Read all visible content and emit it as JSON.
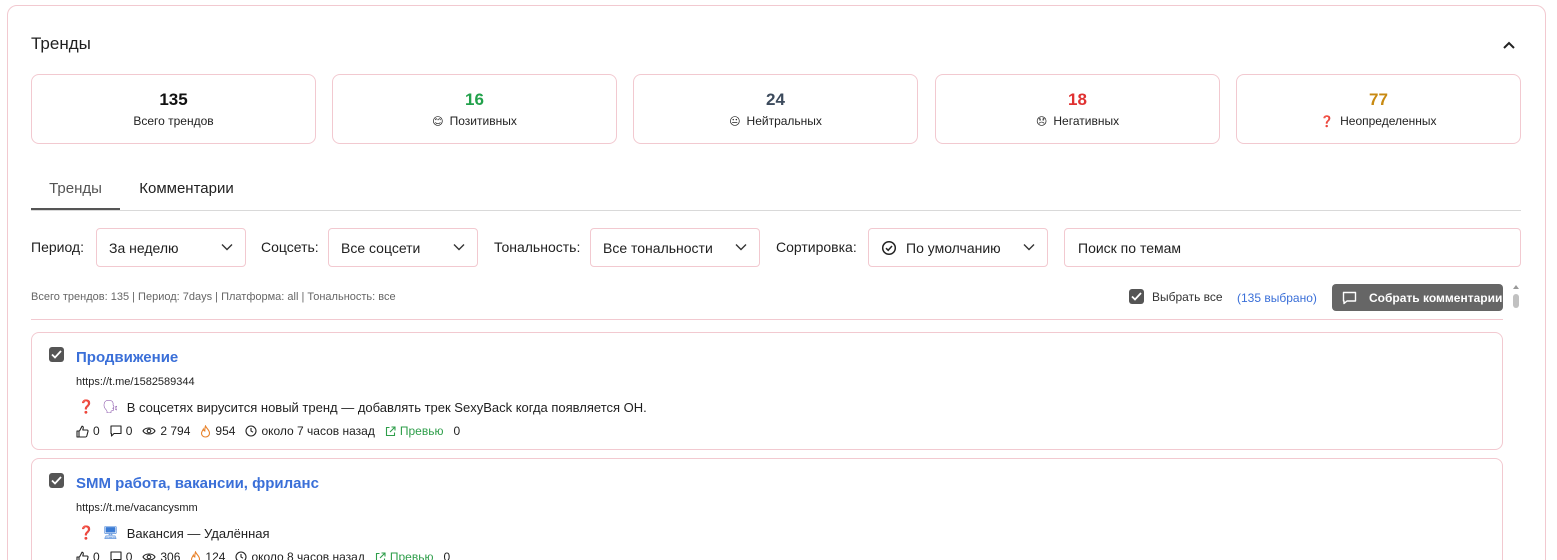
{
  "panel": {
    "title": "Тренды"
  },
  "stats": [
    {
      "value": "135",
      "label": "Всего трендов",
      "color": "#111111",
      "emoji": ""
    },
    {
      "value": "16",
      "label": "Позитивных",
      "color": "#22a14b",
      "emoji": "😊"
    },
    {
      "value": "24",
      "label": "Нейтральных",
      "color": "#3c4a5c",
      "emoji": "😐"
    },
    {
      "value": "18",
      "label": "Негативных",
      "color": "#e03131",
      "emoji": "😞"
    },
    {
      "value": "77",
      "label": "Неопределенных",
      "color": "#c88a12",
      "emoji": "❓"
    }
  ],
  "tabs": [
    {
      "label": "Тренды",
      "active": true
    },
    {
      "label": "Комментарии",
      "active": false
    }
  ],
  "filters": {
    "period_label": "Период:",
    "period_value": "За неделю",
    "network_label": "Соцсеть:",
    "network_value": "Все соцсети",
    "tone_label": "Тональность:",
    "tone_value": "Все тональности",
    "sort_label": "Сортировка:",
    "sort_value": "По умолчанию",
    "search_placeholder": "Поиск по темам"
  },
  "toolbar": {
    "summary": "Всего трендов: 135 | Период: 7days | Платформа: all | Тональность: все",
    "select_all_label": "Выбрать все",
    "selected_count": "(135 выбрано)",
    "collect_button": "Собрать комментарии"
  },
  "trends": [
    {
      "title": "Продвижение",
      "url": "https://t.me/1582589344",
      "sentiment_icon": "❓",
      "topic_icon": "🗣",
      "text": "В соцсетях вирусится новый тренд — добавлять трек SexyBack когда появляется ОН.",
      "likes": "0",
      "comments": "0",
      "views": "2 794",
      "heat": "954",
      "time": "около 7 часов назад",
      "preview_label": "Превью",
      "extra": "0",
      "checked": true
    },
    {
      "title": "SMM работа, вакансии, фриланс",
      "url": "https://t.me/vacancysmm",
      "sentiment_icon": "❓",
      "topic_icon": "🖥",
      "text": "Вакансия — Удалённая",
      "likes": "0",
      "comments": "0",
      "views": "306",
      "heat": "124",
      "time": "около 8 часов назад",
      "preview_label": "Превью",
      "extra": "0",
      "checked": true
    }
  ]
}
